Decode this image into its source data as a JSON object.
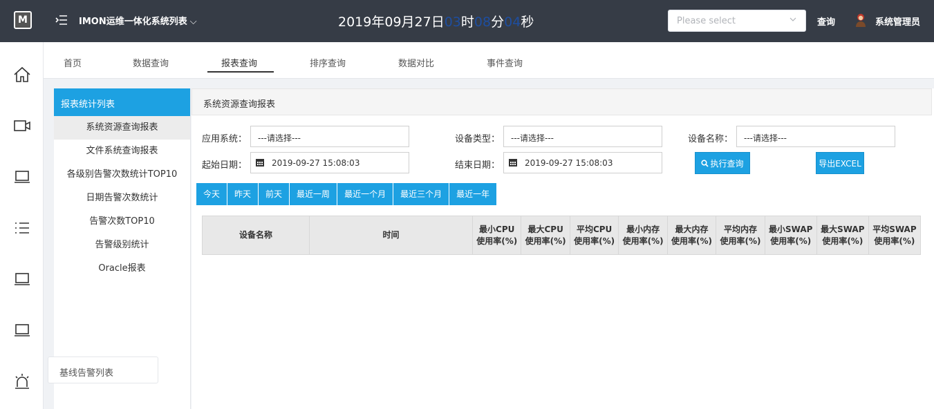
{
  "header": {
    "logo": "M",
    "app_title": "IMON运维一体化系统列表",
    "app_title_chevron": "⌵",
    "clock": {
      "date": "2019年09月27日",
      "hour": "03",
      "hour_unit": "时",
      "minute": "08",
      "minute_unit": "分",
      "second": "04",
      "second_unit": "秒"
    },
    "select_placeholder": "Please select",
    "query_label": "查询",
    "user_name": "系统管理员"
  },
  "rail_icons": [
    "home-icon",
    "video-icon",
    "laptop-icon",
    "list-icon",
    "laptop-icon",
    "laptop-icon",
    "alarm-icon"
  ],
  "tabs": [
    {
      "label": "首页"
    },
    {
      "label": "数据查询"
    },
    {
      "label": "报表查询"
    },
    {
      "label": "排序查询"
    },
    {
      "label": "数据对比"
    },
    {
      "label": "事件查询"
    }
  ],
  "active_tab": "报表查询",
  "report_list": {
    "header": "报表统计列表",
    "items": [
      "系统资源查询报表",
      "文件系统查询报表",
      "各级别告警次数统计TOP10",
      "日期告警次数统计",
      "告警次数TOP10",
      "告警级别统计",
      "Oracle报表"
    ],
    "active_item": "系统资源查询报表"
  },
  "baseline_label": "基线告警列表",
  "content": {
    "title": "系统资源查询报表",
    "filters": {
      "app_system_label": "应用系统：",
      "app_system_value": "---请选择---",
      "device_type_label": "设备类型：",
      "device_type_value": "---请选择---",
      "device_name_label": "设备名称：",
      "device_name_value": "---请选择---",
      "start_date_label": "起始日期：",
      "start_date_value": "2019-09-27 15:08:03",
      "end_date_label": "结束日期：",
      "end_date_value": "2019-09-27 15:08:03",
      "execute_label": "执行查询",
      "export_label": "导出EXCEL"
    },
    "quick_ranges": [
      "今天",
      "昨天",
      "前天",
      "最近一周",
      "最近一个月",
      "最近三个月",
      "最近一年"
    ],
    "table_headers": [
      {
        "l1": "设备名称",
        "l2": ""
      },
      {
        "l1": "时间",
        "l2": ""
      },
      {
        "l1": "最小CPU",
        "l2": "使用率(%)"
      },
      {
        "l1": "最大CPU",
        "l2": "使用率(%)"
      },
      {
        "l1": "平均CPU",
        "l2": "使用率(%)"
      },
      {
        "l1": "最小内存",
        "l2": "使用率(%)"
      },
      {
        "l1": "最大内存",
        "l2": "使用率(%)"
      },
      {
        "l1": "平均内存",
        "l2": "使用率(%)"
      },
      {
        "l1": "最小SWAP",
        "l2": "使用率(%)"
      },
      {
        "l1": "最大SWAP",
        "l2": "使用率(%)"
      },
      {
        "l1": "平均SWAP",
        "l2": "使用率(%)"
      }
    ]
  },
  "colors": {
    "topbar": "#363c46",
    "accent": "#1da1e2",
    "clock_number": "#1e4ea0"
  }
}
